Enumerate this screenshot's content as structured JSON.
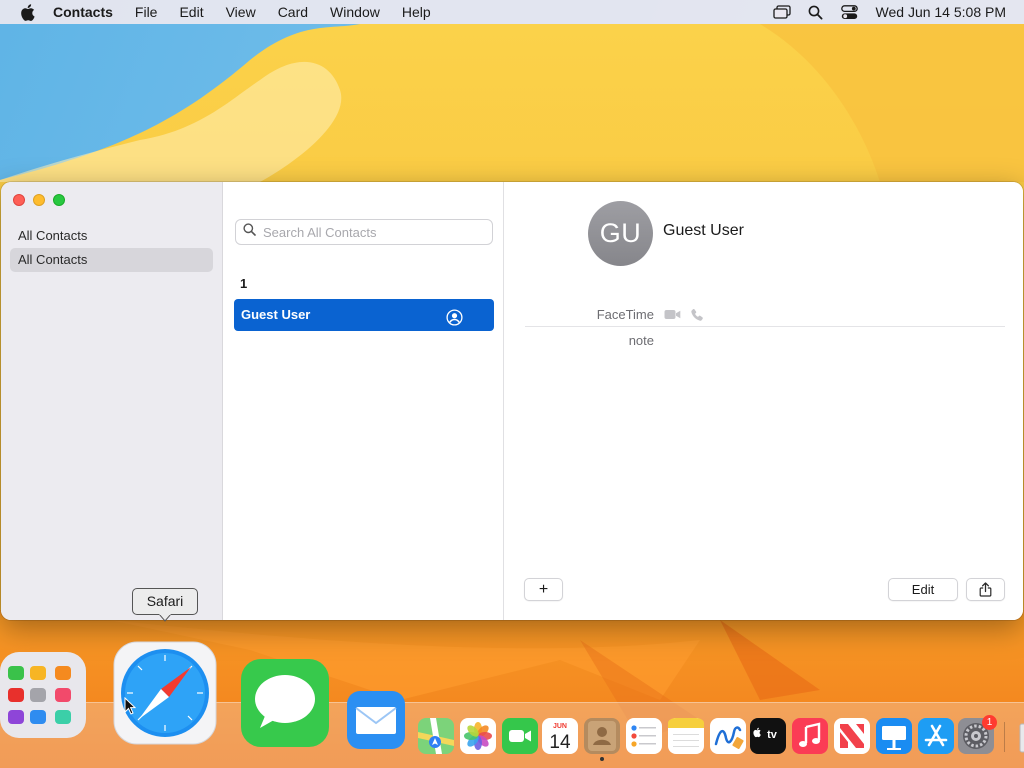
{
  "menubar": {
    "app_name": "Contacts",
    "menus": [
      "File",
      "Edit",
      "View",
      "Card",
      "Window",
      "Help"
    ],
    "clock": "Wed Jun 14  5:08 PM",
    "status_icons": [
      "screen-mirroring-icon",
      "spotlight-search-icon",
      "control-center-icon"
    ]
  },
  "sidebar": {
    "header": "All Contacts",
    "items": [
      {
        "label": "All Contacts",
        "selected": true
      }
    ]
  },
  "list": {
    "search_placeholder": "Search All Contacts",
    "section_letter": "1",
    "contacts": [
      {
        "name": "Guest User",
        "selected": true,
        "is_me": true
      }
    ]
  },
  "detail": {
    "initials": "GU",
    "name": "Guest User",
    "facetime_label": "FaceTime",
    "note_label": "note",
    "add_label": "+",
    "edit_label": "Edit"
  },
  "tooltip": {
    "text": "Safari"
  },
  "dock": {
    "items": [
      "Launchpad",
      "Safari",
      "Messages",
      "Mail",
      "Maps",
      "Photos",
      "FaceTime",
      "Calendar",
      "Contacts",
      "Reminders",
      "Notes",
      "Freeform",
      "TV",
      "Music",
      "News",
      "Keynote",
      "App Store",
      "System Settings"
    ],
    "calendar_month": "JUN",
    "calendar_day": "14",
    "tv_label": "tv",
    "settings_badge": "1"
  },
  "colors": {
    "selection_blue": "#0a63d1",
    "sidebar_bg": "#ecebf0",
    "avatar_gray": "#8e8e93"
  }
}
